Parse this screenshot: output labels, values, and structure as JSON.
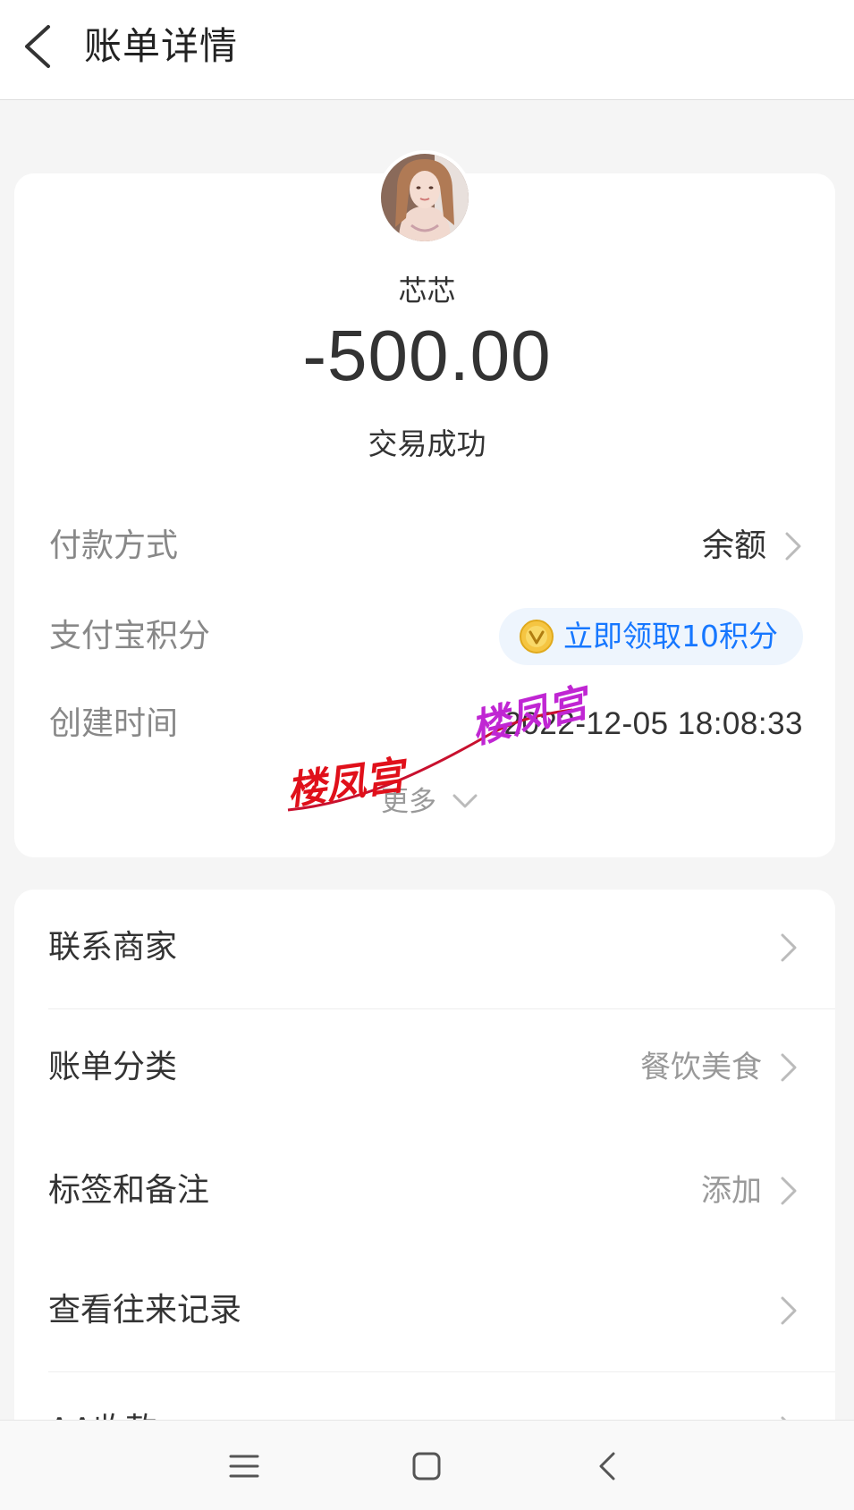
{
  "header": {
    "title": "账单详情"
  },
  "summary": {
    "payee_name": "芯芯",
    "amount": "-500.00",
    "status": "交易成功",
    "payment_method": {
      "label": "付款方式",
      "value": "余额"
    },
    "points": {
      "label": "支付宝积分",
      "button_text": "立即领取10积分"
    },
    "created_time": {
      "label": "创建时间",
      "value": "2022-12-05 18:08:33"
    },
    "more": "更多"
  },
  "watermark": {
    "text": "楼凤宫"
  },
  "list": [
    {
      "label": "联系商家",
      "value": ""
    },
    {
      "label": "账单分类",
      "value": "餐饮美食"
    },
    {
      "label": "标签和备注",
      "value": "添加"
    },
    {
      "label": "查看往来记录",
      "value": ""
    },
    {
      "label": "AA收款",
      "value": ""
    }
  ],
  "colors": {
    "accent": "#1677ff",
    "watermark_red": "#e0101a",
    "watermark_purple": "#c026d3"
  }
}
